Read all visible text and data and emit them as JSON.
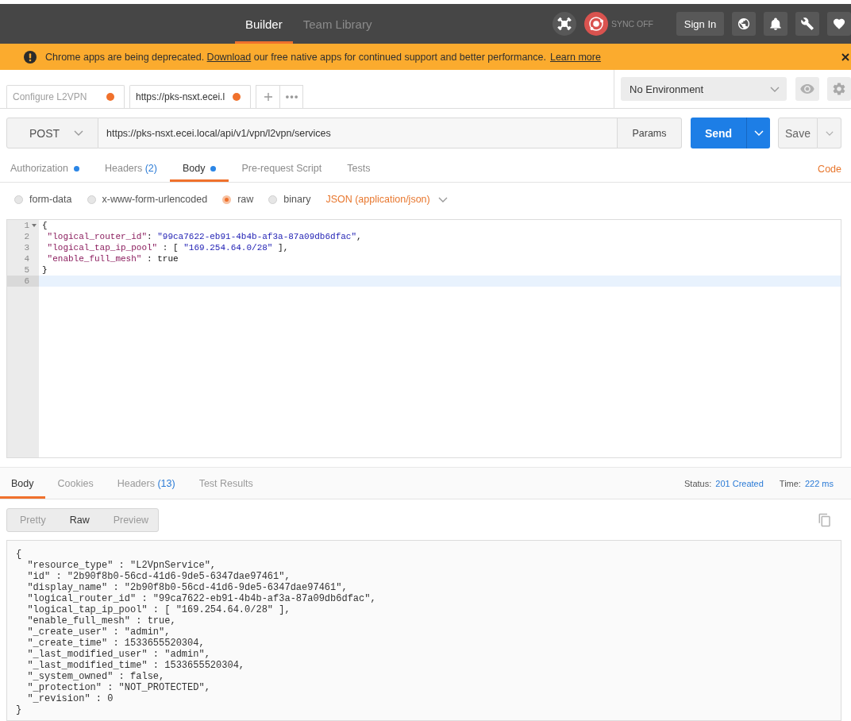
{
  "header": {
    "tabs": [
      {
        "label": "Builder",
        "selected": true
      },
      {
        "label": "Team Library",
        "selected": false
      }
    ],
    "sync": {
      "label": "SYNC OFF",
      "enabled": false
    },
    "sign_in": "Sign In"
  },
  "banner": {
    "message_before": "Chrome apps are being deprecated.",
    "link": "Download",
    "message_after": "our free native apps for continued support and better performance.",
    "learn_more": "Learn more"
  },
  "request_tabs": [
    {
      "label": "Configure L2VPN",
      "selected": false,
      "unsaved": true
    },
    {
      "label": "https://pks-nsxt.ecei.l",
      "selected": true,
      "unsaved": true
    }
  ],
  "environment": {
    "value": "No Environment"
  },
  "request": {
    "method": "POST",
    "url": "https://pks-nsxt.ecei.local/api/v1/vpn/l2vpn/services",
    "params": "Params",
    "send": "Send",
    "save": "Save"
  },
  "request_sections": {
    "tabs": [
      {
        "label": "Authorization",
        "dot": true,
        "selected": false
      },
      {
        "label": "Headers",
        "count": "(2)",
        "dot": false,
        "selected": false
      },
      {
        "label": "Body",
        "dot": true,
        "selected": true
      },
      {
        "label": "Pre-request Script",
        "dot": false,
        "selected": false
      },
      {
        "label": "Tests",
        "dot": false,
        "selected": false
      }
    ],
    "code_link": "Code"
  },
  "body_modes": {
    "options": [
      {
        "label": "form-data",
        "selected": false
      },
      {
        "label": "x-www-form-urlencoded",
        "selected": false
      },
      {
        "label": "raw",
        "selected": true
      },
      {
        "label": "binary",
        "selected": false
      }
    ],
    "format": "JSON (application/json)"
  },
  "editor": {
    "lines": [
      {
        "number": "1",
        "foldable": true,
        "active": false,
        "tokens": [
          {
            "kind": "plain",
            "text": "{"
          }
        ],
        "children": [
          {
            "number": "2",
            "foldable": false,
            "active": false,
            "tokens": [
              {
                "kind": "key",
                "text": "\"logical_router_id\""
              },
              {
                "kind": "plain",
                "text": ": "
              },
              {
                "kind": "string",
                "text": "\"99ca7622-eb91-4b4b-af3a-87a09db6dfac\""
              },
              {
                "kind": "plain",
                "text": ","
              }
            ]
          },
          {
            "number": "3",
            "foldable": false,
            "active": false,
            "tokens": [
              {
                "kind": "key",
                "text": "\"logical_tap_ip_pool\""
              },
              {
                "kind": "plain",
                "text": " : [ "
              },
              {
                "kind": "string",
                "text": "\"169.254.64.0/28\""
              },
              {
                "kind": "plain",
                "text": " ],"
              }
            ]
          },
          {
            "number": "4",
            "foldable": false,
            "active": false,
            "tokens": [
              {
                "kind": "key",
                "text": "\"enable_full_mesh\""
              },
              {
                "kind": "plain",
                "text": " : true"
              }
            ]
          }
        ]
      },
      {
        "number": "5",
        "foldable": false,
        "active": false,
        "tokens": [
          {
            "kind": "plain",
            "text": "}"
          }
        ]
      },
      {
        "number": "6",
        "foldable": false,
        "active": true
      }
    ]
  },
  "response": {
    "tabs": [
      {
        "label": "Body",
        "selected": true
      },
      {
        "label": "Cookies",
        "selected": false
      },
      {
        "label": "Headers",
        "count": "(13)",
        "selected": false
      },
      {
        "label": "Test Results",
        "selected": false
      }
    ],
    "status_label": "Status:",
    "status": "201 Created",
    "time_label": "Time:",
    "time": "222 ms",
    "view_modes": [
      {
        "label": "Pretty",
        "selected": false
      },
      {
        "label": "Raw",
        "selected": true
      },
      {
        "label": "Preview",
        "selected": false
      }
    ],
    "body_lines": [
      "{",
      "  \"resource_type\" : \"L2VpnService\",",
      "  \"id\" : \"2b90f8b0-56cd-41d6-9de5-6347dae97461\",",
      "  \"display_name\" : \"2b90f8b0-56cd-41d6-9de5-6347dae97461\",",
      "  \"logical_router_id\" : \"99ca7622-eb91-4b4b-af3a-87a09db6dfac\",",
      "  \"logical_tap_ip_pool\" : [ \"169.254.64.0/28\" ],",
      "  \"enable_full_mesh\" : true,",
      "  \"_create_user\" : \"admin\",",
      "  \"_create_time\" : 1533655520304,",
      "  \"_last_modified_user\" : \"admin\",",
      "  \"_last_modified_time\" : 1533655520304,",
      "  \"_system_owned\" : false,",
      "  \"_protection\" : \"NOT_PROTECTED\",",
      "  \"_revision\" : 0",
      "}"
    ]
  }
}
